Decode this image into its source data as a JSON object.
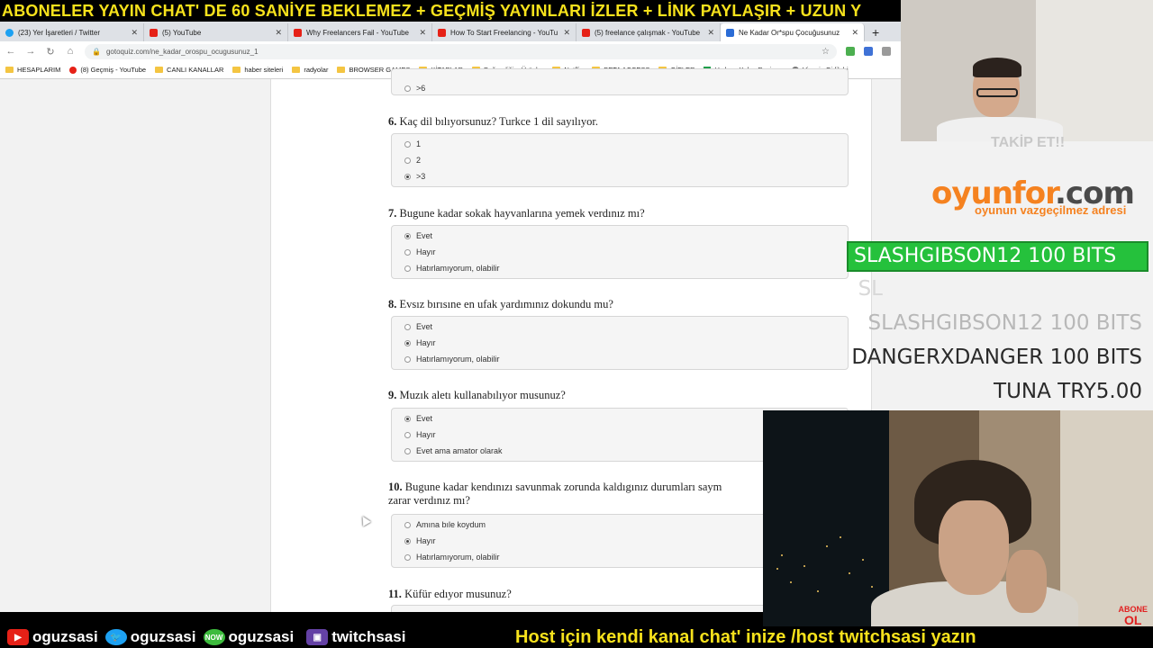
{
  "ticker": "ABONELER YAYIN CHAT' DE 60 SANİYE BEKLEMEZ + GEÇMİŞ YAYINLARI İZLER + LİNK PAYLAŞIR + UZUN Y",
  "browser": {
    "tabs": [
      {
        "label": "(23) Yer İşaretleri / Twitter",
        "icon": "twitter-icon"
      },
      {
        "label": "(5) YouTube",
        "icon": "youtube-icon"
      },
      {
        "label": "Why Freelancers Fail - YouTube",
        "icon": "youtube-icon"
      },
      {
        "label": "How To Start Freelancing - YouTu",
        "icon": "youtube-icon"
      },
      {
        "label": "(5) freelance çalışmak - YouTube",
        "icon": "youtube-icon"
      },
      {
        "label": "Ne Kadar Or*spu Çocuğusunuz",
        "icon": "gotoquiz-icon",
        "active": true
      }
    ],
    "url": "gotoquiz.com/ne_kadar_orospu_ocugusunuz_1",
    "bookmarks": [
      "HESAPLARIM",
      "(8) Geçmiş - YouTube",
      "CANLI KANALLAR",
      "haber siteleri",
      "radyolar",
      "BROWSER GAMES",
      "KİTAPLAR",
      "Beğendiğim Ürünler",
      "Netflix",
      "BETA ACCESS",
      "GİFLER",
      "Hızlı ve Kolay Resim...",
      "Vizesiz Gidilebi"
    ]
  },
  "quiz": {
    "prev_option": ">6",
    "questions": [
      {
        "num": "6.",
        "text": "Kaç dil bılıyorsunuz? Turkce 1 dil sayılıyor.",
        "options": [
          {
            "label": "1",
            "selected": false
          },
          {
            "label": "2",
            "selected": false
          },
          {
            "label": ">3",
            "selected": true
          }
        ]
      },
      {
        "num": "7.",
        "text": "Bugune kadar sokak hayvanlarına yemek verdınız mı?",
        "options": [
          {
            "label": "Evet",
            "selected": true
          },
          {
            "label": "Hayır",
            "selected": false
          },
          {
            "label": "Hatırlamıyorum, olabilir",
            "selected": false
          }
        ]
      },
      {
        "num": "8.",
        "text": "Evsız bırısıne en ufak yardımınız dokundu mu?",
        "options": [
          {
            "label": "Evet",
            "selected": false
          },
          {
            "label": "Hayır",
            "selected": true
          },
          {
            "label": "Hatırlamıyorum, olabilir",
            "selected": false
          }
        ]
      },
      {
        "num": "9.",
        "text": "Muzık aletı kullanabılıyor musunuz?",
        "options": [
          {
            "label": "Evet",
            "selected": true
          },
          {
            "label": "Hayır",
            "selected": false
          },
          {
            "label": "Evet ama amator olarak",
            "selected": false
          }
        ]
      },
      {
        "num": "10.",
        "text": "Bugune kadar kendınızı savunmak zorunda kaldıgınız durumları saym",
        "text2": "zarar verdınız mı?",
        "options": [
          {
            "label": "Amına bıle koydum",
            "selected": false
          },
          {
            "label": "Hayır",
            "selected": true
          },
          {
            "label": "Hatırlamıyorum, olabilir",
            "selected": false
          }
        ]
      },
      {
        "num": "11.",
        "text": "Küfür edıyor musunuz?"
      }
    ]
  },
  "overlay": {
    "faded_text": "TAKİP ET!!",
    "logo_main": "oyunfor",
    "logo_tld": ".com",
    "logo_sub": "oyunun vazgeçilmez adresi",
    "alert": "SLASHGIBSON12  100 BITS",
    "ghost": "SL",
    "donors": [
      {
        "text": "SLASHGIBSON12  100 BITS"
      },
      {
        "text": "DANGERXDANGER  100 BITS"
      },
      {
        "text": "TUNA  TRY5.00"
      }
    ],
    "abone_line1": "ABONE",
    "abone_line2": "OL"
  },
  "bottom": {
    "youtube": "oguzsasi",
    "twitter": "oguzsasi",
    "now": "oguzsasi",
    "twitch": "twitchsasi",
    "now_label": "NOW",
    "host": "Host için kendi kanal chat' inize /host twitchsasi yazın"
  }
}
